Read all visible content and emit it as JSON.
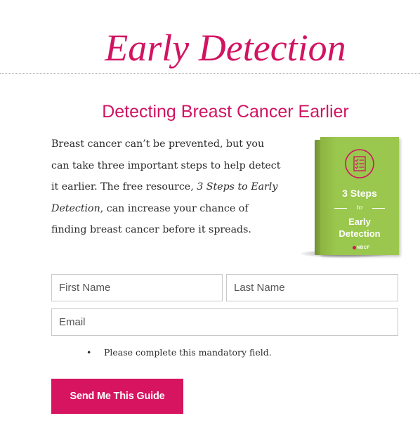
{
  "header": {
    "title": "Early Detection"
  },
  "section": {
    "heading": "Detecting Breast Cancer Earlier",
    "intro_before": "Breast cancer can’t be prevented, but you can take three important steps to help detect it earlier. The free resource, ",
    "intro_emphasis": "3 Steps to Early Detection",
    "intro_after": ", can increase your chance of finding breast cancer before it spreads."
  },
  "book": {
    "title_top": "3 Steps",
    "title_connector": "to",
    "title_bottom_line1": "Early",
    "title_bottom_line2": "Detection",
    "logo_text": "NBCF",
    "cover_color": "#9bc74e",
    "icon": "checklist-icon"
  },
  "form": {
    "first_name_placeholder": "First Name",
    "last_name_placeholder": "Last Name",
    "email_placeholder": "Email",
    "first_name_value": "",
    "last_name_value": "",
    "email_value": "",
    "error_message": "Please complete this mandatory field.",
    "submit_label": "Send Me This Guide"
  },
  "colors": {
    "accent": "#d11462",
    "button": "#d6145f",
    "body_text": "#2b2b2b"
  }
}
